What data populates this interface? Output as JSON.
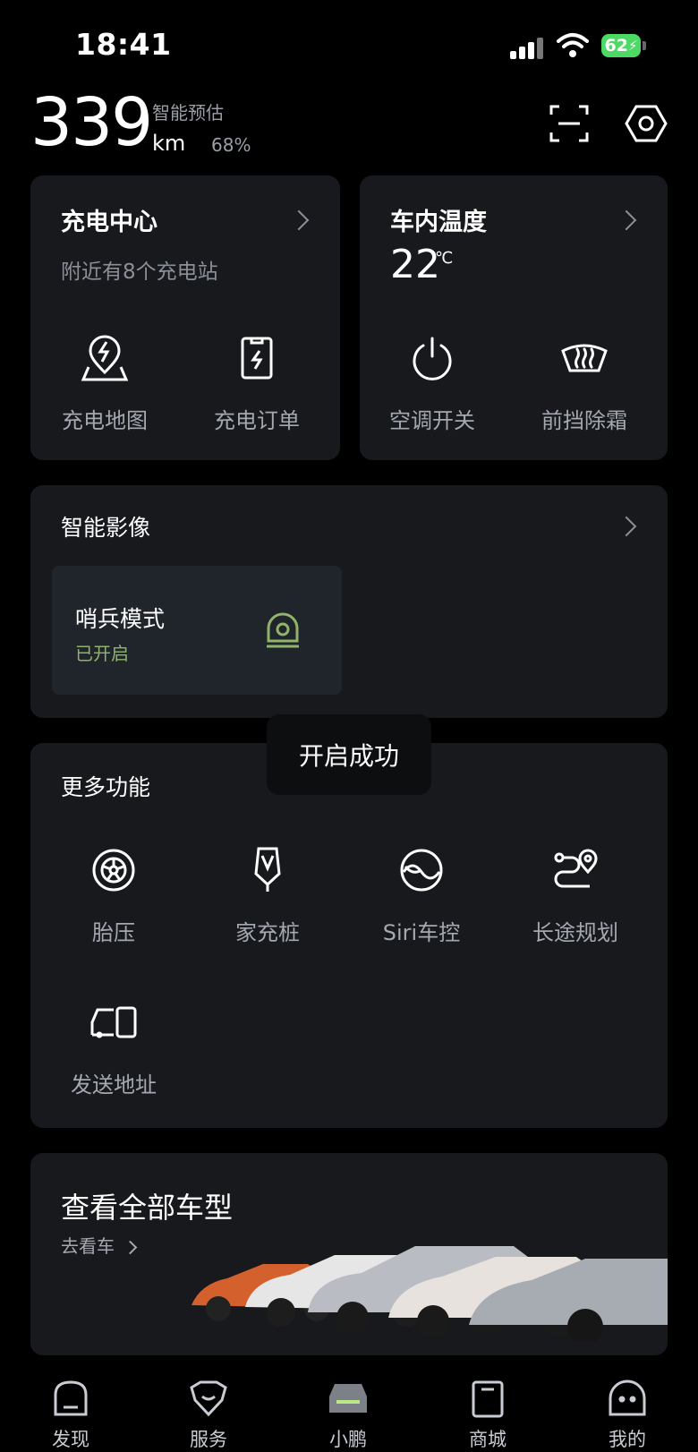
{
  "status": {
    "time": "18:41",
    "battery": "62"
  },
  "header": {
    "range": "339",
    "unit": "km",
    "estimate_label": "智能预估",
    "percent": "68%"
  },
  "charging": {
    "title": "充电中心",
    "subtitle": "附近有8个充电站",
    "actions": [
      "充电地图",
      "充电订单"
    ]
  },
  "climate": {
    "title": "车内温度",
    "temperature": "22",
    "unit": "℃",
    "actions": [
      "空调开关",
      "前挡除霜"
    ]
  },
  "imaging": {
    "title": "智能影像",
    "sentry_title": "哨兵模式",
    "sentry_status": "已开启"
  },
  "toast": "开启成功",
  "more": {
    "title": "更多功能",
    "items": [
      "胎压",
      "家充桩",
      "Siri车控",
      "长途规划",
      "发送地址"
    ]
  },
  "models": {
    "title": "查看全部车型",
    "link": "去看车"
  },
  "tabs": [
    "发现",
    "服务",
    "小鹏",
    "商城",
    "我的"
  ],
  "colors": {
    "accent_green": "#8fb36a",
    "card_bg": "#17191d",
    "battery_green": "#4cd964"
  }
}
